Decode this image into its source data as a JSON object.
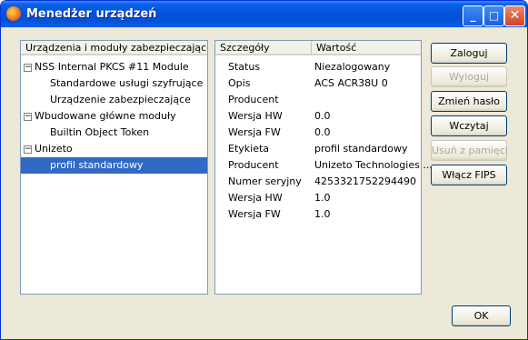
{
  "window": {
    "title": "Menedżer urządzeń",
    "controls": {
      "minimize": "_",
      "maximize": "□",
      "close": "✕"
    }
  },
  "tree": {
    "header": "Urządzenia i moduły zabezpieczające",
    "items": [
      {
        "label": "NSS Internal PKCS #11 Module",
        "expander": "−"
      },
      {
        "label": "Standardowe usługi szyfrujące"
      },
      {
        "label": "Urządzenie zabezpieczające"
      },
      {
        "label": "Wbudowane główne moduły",
        "expander": "−"
      },
      {
        "label": "Builtin Object Token"
      },
      {
        "label": "Unizeto",
        "expander": "−"
      },
      {
        "label": "profil standardowy",
        "selected": true
      }
    ]
  },
  "details": {
    "header_name": "Szczegóły",
    "header_value": "Wartość",
    "rows": [
      {
        "name": "Status",
        "value": "Niezalogowany"
      },
      {
        "name": "Opis",
        "value": "ACS ACR38U 0"
      },
      {
        "name": "Producent",
        "value": ""
      },
      {
        "name": "Wersja HW",
        "value": "0.0"
      },
      {
        "name": "Wersja FW",
        "value": "0.0"
      },
      {
        "name": "Etykieta",
        "value": "profil standardowy"
      },
      {
        "name": "Producent",
        "value": "Unizeto Technologies ..."
      },
      {
        "name": "Numer seryjny",
        "value": "4253321752294490"
      },
      {
        "name": "Wersja HW",
        "value": "1.0"
      },
      {
        "name": "Wersja FW",
        "value": "1.0"
      }
    ]
  },
  "buttons": {
    "login": "Zaloguj",
    "logout": "Wyloguj",
    "change_password": "Zmień hasło",
    "load": "Wczytaj",
    "unload": "Usuń z pamięci",
    "enable_fips": "Włącz FIPS",
    "ok": "OK"
  }
}
